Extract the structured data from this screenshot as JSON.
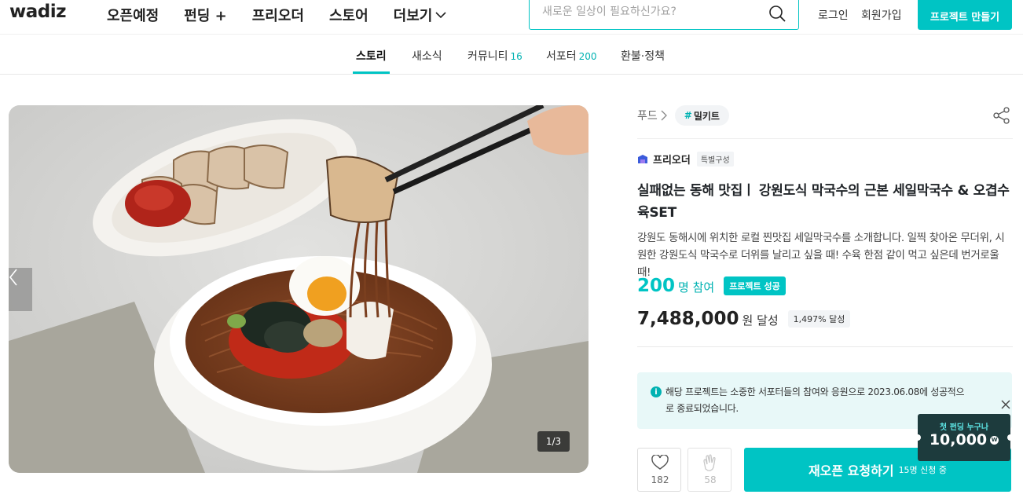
{
  "header": {
    "logo": "wadiz",
    "nav": [
      "오픈예정",
      "펀딩 +",
      "프리오더",
      "스토어",
      "더보기"
    ],
    "search_placeholder": "새로운 일상이 필요하신가요?",
    "login": "로그인",
    "signup": "회원가입",
    "make_project": "프로젝트 만들기"
  },
  "tabs": [
    {
      "label": "스토리",
      "count": ""
    },
    {
      "label": "새소식",
      "count": ""
    },
    {
      "label": "커뮤니티",
      "count": "16"
    },
    {
      "label": "서포터",
      "count": "200"
    },
    {
      "label": "환불·정책",
      "count": ""
    }
  ],
  "gallery": {
    "page_indicator": "1/3"
  },
  "project": {
    "category": "푸드",
    "tag_hash": "#",
    "tag": "밀키트",
    "type_label": "프리오더",
    "type_badge": "특별구성",
    "title": "실패없는 동해 맛집ㅣ 강원도식 막국수의 근본 세일막국수 & 오겹수육SET",
    "description": "강원도 동해시에 위치한 로컬 찐맛집 세일막국수를 소개합니다. 일찍 찾아온 무더위, 시원한 강원도식 막국수로 더위를 날리고 싶을 때! 수육 한점 같이 먹고 싶은데 번거로울 때!",
    "participants": "200",
    "participants_unit": "명 참여",
    "success_badge": "프로젝트 성공",
    "amount": "7,488,000",
    "amount_unit": "원 달성",
    "rate": "1,497% 달성",
    "notice_icon": "i",
    "notice": "해당 프로젝트는 소중한 서포터들의 참여와 응원으로 2023.06.08에 성공적으로 종료되었습니다.",
    "likes": "182",
    "cheers": "58",
    "reopen_label": "재오픈 요청하기",
    "reopen_sub": "15명 신청 중"
  },
  "promo": {
    "line1": "첫 펀딩 누구나",
    "amount": "10,000",
    "won_symbol": "W"
  },
  "colors": {
    "accent": "#00c4c4",
    "accent_text": "#00b2b2"
  }
}
